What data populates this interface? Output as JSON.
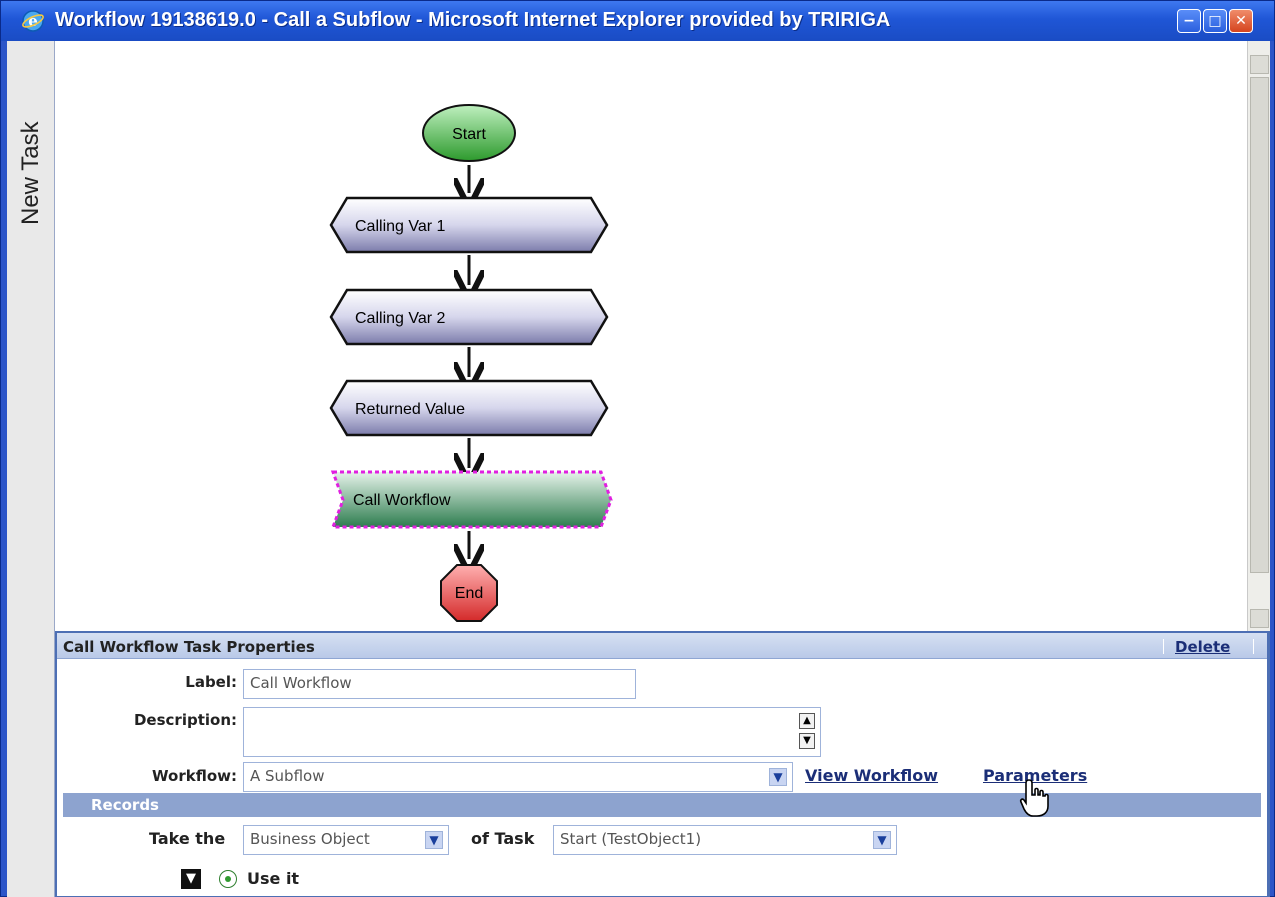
{
  "window": {
    "title": "Workflow 19138619.0 - Call a Subflow - Microsoft Internet Explorer provided by TRIRIGA",
    "minimize": "−",
    "maximize": "□",
    "close": "✕"
  },
  "sidebar": {
    "tab_label": "New Task"
  },
  "flow": {
    "start": "Start",
    "steps": [
      "Calling Var 1",
      "Calling Var 2",
      "Returned Value"
    ],
    "selected_step": "Call Workflow",
    "end": "End"
  },
  "properties": {
    "title": "Call Workflow Task Properties",
    "delete_label": "Delete",
    "label_field": {
      "label": "Label:",
      "value": "Call Workflow"
    },
    "description_field": {
      "label": "Description:",
      "value": ""
    },
    "workflow_field": {
      "label": "Workflow:",
      "value": "A Subflow"
    },
    "view_workflow_label": "View Workflow",
    "parameters_label": "Parameters",
    "records": {
      "title": "Records",
      "take_the_label": "Take the",
      "take_the_value": "Business Object",
      "of_task_label": "of Task",
      "of_task_value": "Start (TestObject1)",
      "use_it_label": "Use it"
    }
  },
  "colors": {
    "titlebar": "#1f56d6",
    "start_node": "#2f9a2f",
    "end_node": "#d42a2a",
    "selection_outline": "#e020e0",
    "header_panel": "#b9c9e8"
  }
}
